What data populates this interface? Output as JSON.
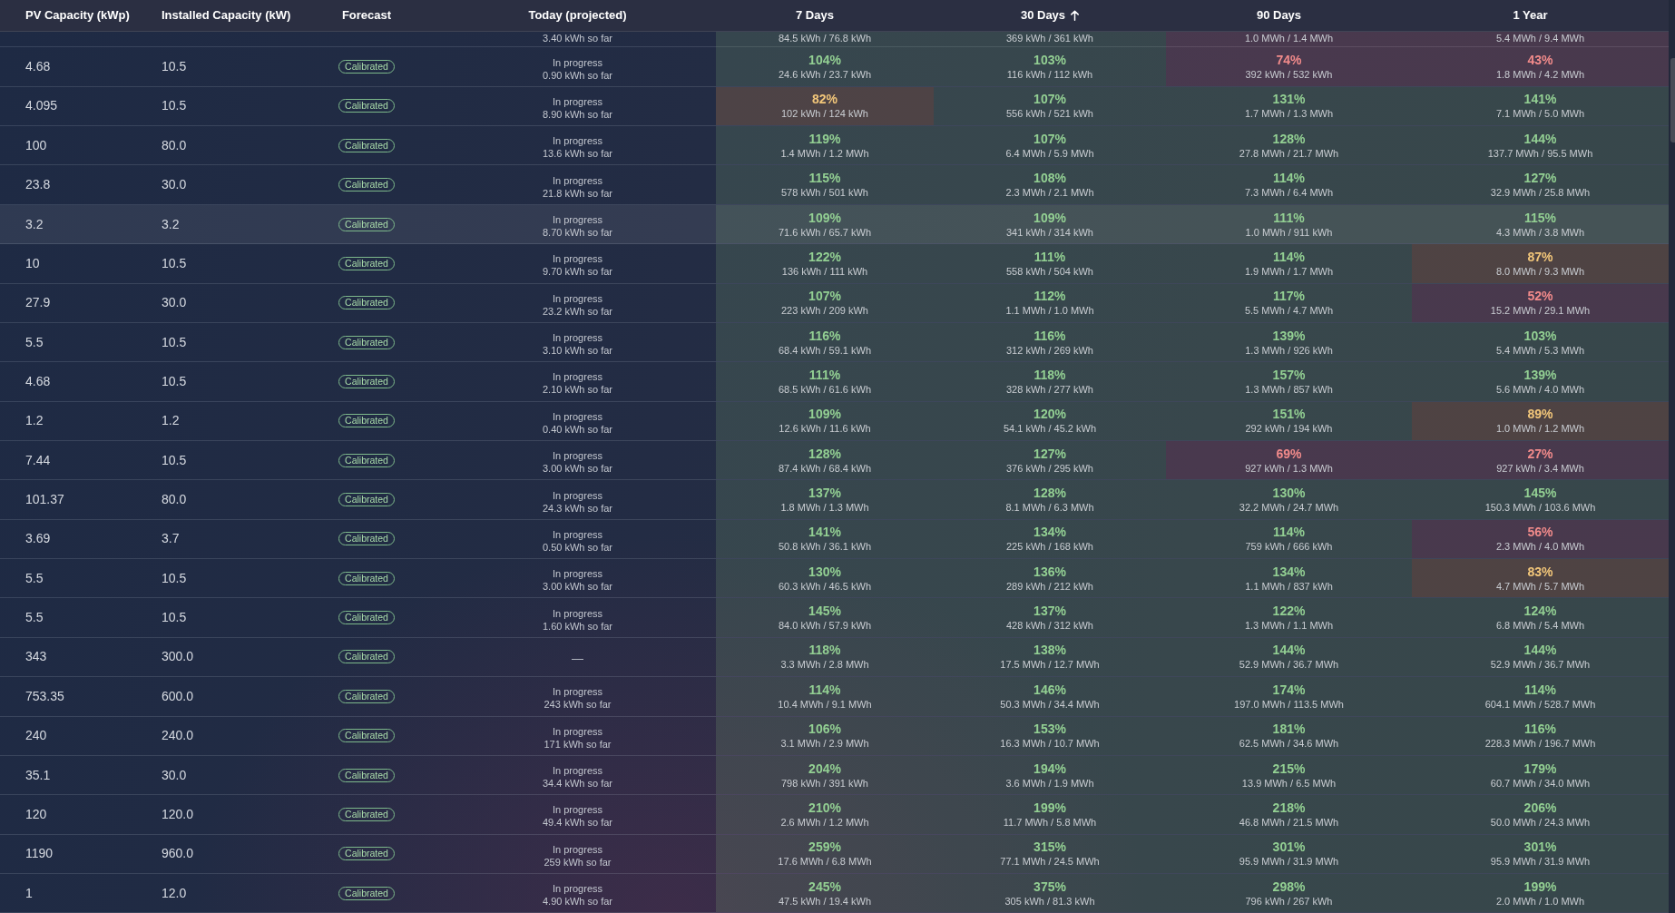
{
  "table": {
    "columns": [
      {
        "label": "PV Capacity (kWp)",
        "sorted": false
      },
      {
        "label": "Installed Capacity (kW)",
        "sorted": false
      },
      {
        "label": "Forecast",
        "sorted": false
      },
      {
        "label": "Today (projected)",
        "sorted": false
      },
      {
        "label": "7 Days",
        "sorted": false
      },
      {
        "label": "30 Days",
        "sorted": true
      },
      {
        "label": "90 Days",
        "sorted": false
      },
      {
        "label": "1 Year",
        "sorted": false
      }
    ],
    "partial_row": {
      "today_detail": "3.40 kWh so far",
      "periods": [
        {
          "energy": "84.5 kWh / 76.8 kWh",
          "kind": "good"
        },
        {
          "energy": "369 kWh / 361 kWh",
          "kind": "good"
        },
        {
          "energy": "1.0 MWh / 1.4 MWh",
          "kind": "bad"
        },
        {
          "energy": "5.4 MWh / 9.4 MWh",
          "kind": "bad"
        }
      ]
    },
    "rows": [
      {
        "pv_capacity": "4.68",
        "installed_capacity": "10.5",
        "forecast": "Calibrated",
        "today": {
          "kind": "progress",
          "label": "In progress",
          "detail": "0.90 kWh so far"
        },
        "highlighted": false,
        "periods": [
          {
            "percent": "104%",
            "energy": "24.6 kWh / 23.7 kWh",
            "kind": "good"
          },
          {
            "percent": "103%",
            "energy": "116 kWh / 112 kWh",
            "kind": "good"
          },
          {
            "percent": "74%",
            "energy": "392 kWh / 532 kWh",
            "kind": "bad"
          },
          {
            "percent": "43%",
            "energy": "1.8 MWh / 4.2 MWh",
            "kind": "bad"
          }
        ]
      },
      {
        "pv_capacity": "4.095",
        "installed_capacity": "10.5",
        "forecast": "Calibrated",
        "today": {
          "kind": "progress",
          "label": "In progress",
          "detail": "8.90 kWh so far"
        },
        "highlighted": false,
        "periods": [
          {
            "percent": "82%",
            "energy": "102 kWh / 124 kWh",
            "kind": "warn"
          },
          {
            "percent": "107%",
            "energy": "556 kWh / 521 kWh",
            "kind": "good"
          },
          {
            "percent": "131%",
            "energy": "1.7 MWh / 1.3 MWh",
            "kind": "good"
          },
          {
            "percent": "141%",
            "energy": "7.1 MWh / 5.0 MWh",
            "kind": "good"
          }
        ]
      },
      {
        "pv_capacity": "100",
        "installed_capacity": "80.0",
        "forecast": "Calibrated",
        "today": {
          "kind": "progress",
          "label": "In progress",
          "detail": "13.6 kWh so far"
        },
        "highlighted": false,
        "periods": [
          {
            "percent": "119%",
            "energy": "1.4 MWh / 1.2 MWh",
            "kind": "good"
          },
          {
            "percent": "107%",
            "energy": "6.4 MWh / 5.9 MWh",
            "kind": "good"
          },
          {
            "percent": "128%",
            "energy": "27.8 MWh / 21.7 MWh",
            "kind": "good"
          },
          {
            "percent": "144%",
            "energy": "137.7 MWh / 95.5 MWh",
            "kind": "good"
          }
        ]
      },
      {
        "pv_capacity": "23.8",
        "installed_capacity": "30.0",
        "forecast": "Calibrated",
        "today": {
          "kind": "progress",
          "label": "In progress",
          "detail": "21.8 kWh so far"
        },
        "highlighted": false,
        "periods": [
          {
            "percent": "115%",
            "energy": "578 kWh / 501 kWh",
            "kind": "good"
          },
          {
            "percent": "108%",
            "energy": "2.3 MWh / 2.1 MWh",
            "kind": "good"
          },
          {
            "percent": "114%",
            "energy": "7.3 MWh / 6.4 MWh",
            "kind": "good"
          },
          {
            "percent": "127%",
            "energy": "32.9 MWh / 25.8 MWh",
            "kind": "good"
          }
        ]
      },
      {
        "pv_capacity": "3.2",
        "installed_capacity": "3.2",
        "forecast": "Calibrated",
        "today": {
          "kind": "progress",
          "label": "In progress",
          "detail": "8.70 kWh so far"
        },
        "highlighted": true,
        "periods": [
          {
            "percent": "109%",
            "energy": "71.6 kWh / 65.7 kWh",
            "kind": "good"
          },
          {
            "percent": "109%",
            "energy": "341 kWh / 314 kWh",
            "kind": "good"
          },
          {
            "percent": "111%",
            "energy": "1.0 MWh / 911 kWh",
            "kind": "good"
          },
          {
            "percent": "115%",
            "energy": "4.3 MWh / 3.8 MWh",
            "kind": "good"
          }
        ]
      },
      {
        "pv_capacity": "10",
        "installed_capacity": "10.5",
        "forecast": "Calibrated",
        "today": {
          "kind": "progress",
          "label": "In progress",
          "detail": "9.70 kWh so far"
        },
        "highlighted": false,
        "periods": [
          {
            "percent": "122%",
            "energy": "136 kWh / 111 kWh",
            "kind": "good"
          },
          {
            "percent": "111%",
            "energy": "558 kWh / 504 kWh",
            "kind": "good"
          },
          {
            "percent": "114%",
            "energy": "1.9 MWh / 1.7 MWh",
            "kind": "good"
          },
          {
            "percent": "87%",
            "energy": "8.0 MWh / 9.3 MWh",
            "kind": "warn"
          }
        ]
      },
      {
        "pv_capacity": "27.9",
        "installed_capacity": "30.0",
        "forecast": "Calibrated",
        "today": {
          "kind": "progress",
          "label": "In progress",
          "detail": "23.2 kWh so far"
        },
        "highlighted": false,
        "periods": [
          {
            "percent": "107%",
            "energy": "223 kWh / 209 kWh",
            "kind": "good"
          },
          {
            "percent": "112%",
            "energy": "1.1 MWh / 1.0 MWh",
            "kind": "good"
          },
          {
            "percent": "117%",
            "energy": "5.5 MWh / 4.7 MWh",
            "kind": "good"
          },
          {
            "percent": "52%",
            "energy": "15.2 MWh / 29.1 MWh",
            "kind": "bad"
          }
        ]
      },
      {
        "pv_capacity": "5.5",
        "installed_capacity": "10.5",
        "forecast": "Calibrated",
        "today": {
          "kind": "progress",
          "label": "In progress",
          "detail": "3.10 kWh so far"
        },
        "highlighted": false,
        "periods": [
          {
            "percent": "116%",
            "energy": "68.4 kWh / 59.1 kWh",
            "kind": "good"
          },
          {
            "percent": "116%",
            "energy": "312 kWh / 269 kWh",
            "kind": "good"
          },
          {
            "percent": "139%",
            "energy": "1.3 MWh / 926 kWh",
            "kind": "good"
          },
          {
            "percent": "103%",
            "energy": "5.4 MWh / 5.3 MWh",
            "kind": "good"
          }
        ]
      },
      {
        "pv_capacity": "4.68",
        "installed_capacity": "10.5",
        "forecast": "Calibrated",
        "today": {
          "kind": "progress",
          "label": "In progress",
          "detail": "2.10 kWh so far"
        },
        "highlighted": false,
        "periods": [
          {
            "percent": "111%",
            "energy": "68.5 kWh / 61.6 kWh",
            "kind": "good"
          },
          {
            "percent": "118%",
            "energy": "328 kWh / 277 kWh",
            "kind": "good"
          },
          {
            "percent": "157%",
            "energy": "1.3 MWh / 857 kWh",
            "kind": "good"
          },
          {
            "percent": "139%",
            "energy": "5.6 MWh / 4.0 MWh",
            "kind": "good"
          }
        ]
      },
      {
        "pv_capacity": "1.2",
        "installed_capacity": "1.2",
        "forecast": "Calibrated",
        "today": {
          "kind": "progress",
          "label": "In progress",
          "detail": "0.40 kWh so far"
        },
        "highlighted": false,
        "periods": [
          {
            "percent": "109%",
            "energy": "12.6 kWh / 11.6 kWh",
            "kind": "good"
          },
          {
            "percent": "120%",
            "energy": "54.1 kWh / 45.2 kWh",
            "kind": "good"
          },
          {
            "percent": "151%",
            "energy": "292 kWh / 194 kWh",
            "kind": "good"
          },
          {
            "percent": "89%",
            "energy": "1.0 MWh / 1.2 MWh",
            "kind": "warn"
          }
        ]
      },
      {
        "pv_capacity": "7.44",
        "installed_capacity": "10.5",
        "forecast": "Calibrated",
        "today": {
          "kind": "progress",
          "label": "In progress",
          "detail": "3.00 kWh so far"
        },
        "highlighted": false,
        "periods": [
          {
            "percent": "128%",
            "energy": "87.4 kWh / 68.4 kWh",
            "kind": "good"
          },
          {
            "percent": "127%",
            "energy": "376 kWh / 295 kWh",
            "kind": "good"
          },
          {
            "percent": "69%",
            "energy": "927 kWh / 1.3 MWh",
            "kind": "bad"
          },
          {
            "percent": "27%",
            "energy": "927 kWh / 3.4 MWh",
            "kind": "bad"
          }
        ]
      },
      {
        "pv_capacity": "101.37",
        "installed_capacity": "80.0",
        "forecast": "Calibrated",
        "today": {
          "kind": "progress",
          "label": "In progress",
          "detail": "24.3 kWh so far"
        },
        "highlighted": false,
        "periods": [
          {
            "percent": "137%",
            "energy": "1.8 MWh / 1.3 MWh",
            "kind": "good"
          },
          {
            "percent": "128%",
            "energy": "8.1 MWh / 6.3 MWh",
            "kind": "good"
          },
          {
            "percent": "130%",
            "energy": "32.2 MWh / 24.7 MWh",
            "kind": "good"
          },
          {
            "percent": "145%",
            "energy": "150.3 MWh / 103.6 MWh",
            "kind": "good"
          }
        ]
      },
      {
        "pv_capacity": "3.69",
        "installed_capacity": "3.7",
        "forecast": "Calibrated",
        "today": {
          "kind": "progress",
          "label": "In progress",
          "detail": "0.50 kWh so far"
        },
        "highlighted": false,
        "periods": [
          {
            "percent": "141%",
            "energy": "50.8 kWh / 36.1 kWh",
            "kind": "good"
          },
          {
            "percent": "134%",
            "energy": "225 kWh / 168 kWh",
            "kind": "good"
          },
          {
            "percent": "114%",
            "energy": "759 kWh / 666 kWh",
            "kind": "good"
          },
          {
            "percent": "56%",
            "energy": "2.3 MWh / 4.0 MWh",
            "kind": "bad"
          }
        ]
      },
      {
        "pv_capacity": "5.5",
        "installed_capacity": "10.5",
        "forecast": "Calibrated",
        "today": {
          "kind": "progress",
          "label": "In progress",
          "detail": "3.00 kWh so far"
        },
        "highlighted": false,
        "periods": [
          {
            "percent": "130%",
            "energy": "60.3 kWh / 46.5 kWh",
            "kind": "good"
          },
          {
            "percent": "136%",
            "energy": "289 kWh / 212 kWh",
            "kind": "good"
          },
          {
            "percent": "134%",
            "energy": "1.1 MWh / 837 kWh",
            "kind": "good"
          },
          {
            "percent": "83%",
            "energy": "4.7 MWh / 5.7 MWh",
            "kind": "warn"
          }
        ]
      },
      {
        "pv_capacity": "5.5",
        "installed_capacity": "10.5",
        "forecast": "Calibrated",
        "today": {
          "kind": "progress",
          "label": "In progress",
          "detail": "1.60 kWh so far"
        },
        "highlighted": false,
        "periods": [
          {
            "percent": "145%",
            "energy": "84.0 kWh / 57.9 kWh",
            "kind": "good"
          },
          {
            "percent": "137%",
            "energy": "428 kWh / 312 kWh",
            "kind": "good"
          },
          {
            "percent": "122%",
            "energy": "1.3 MWh / 1.1 MWh",
            "kind": "good"
          },
          {
            "percent": "124%",
            "energy": "6.8 MWh / 5.4 MWh",
            "kind": "good"
          }
        ]
      },
      {
        "pv_capacity": "343",
        "installed_capacity": "300.0",
        "forecast": "Calibrated",
        "today": {
          "kind": "none",
          "label": "—"
        },
        "highlighted": false,
        "periods": [
          {
            "percent": "118%",
            "energy": "3.3 MWh / 2.8 MWh",
            "kind": "good"
          },
          {
            "percent": "138%",
            "energy": "17.5 MWh / 12.7 MWh",
            "kind": "good"
          },
          {
            "percent": "144%",
            "energy": "52.9 MWh / 36.7 MWh",
            "kind": "good"
          },
          {
            "percent": "144%",
            "energy": "52.9 MWh / 36.7 MWh",
            "kind": "good"
          }
        ]
      },
      {
        "pv_capacity": "753.35",
        "installed_capacity": "600.0",
        "forecast": "Calibrated",
        "today": {
          "kind": "progress",
          "label": "In progress",
          "detail": "243 kWh so far"
        },
        "highlighted": false,
        "periods": [
          {
            "percent": "114%",
            "energy": "10.4 MWh / 9.1 MWh",
            "kind": "good"
          },
          {
            "percent": "146%",
            "energy": "50.3 MWh / 34.4 MWh",
            "kind": "good"
          },
          {
            "percent": "174%",
            "energy": "197.0 MWh / 113.5 MWh",
            "kind": "good"
          },
          {
            "percent": "114%",
            "energy": "604.1 MWh / 528.7 MWh",
            "kind": "good"
          }
        ]
      },
      {
        "pv_capacity": "240",
        "installed_capacity": "240.0",
        "forecast": "Calibrated",
        "today": {
          "kind": "progress",
          "label": "In progress",
          "detail": "171 kWh so far"
        },
        "highlighted": false,
        "periods": [
          {
            "percent": "106%",
            "energy": "3.1 MWh / 2.9 MWh",
            "kind": "good"
          },
          {
            "percent": "153%",
            "energy": "16.3 MWh / 10.7 MWh",
            "kind": "good"
          },
          {
            "percent": "181%",
            "energy": "62.5 MWh / 34.6 MWh",
            "kind": "good"
          },
          {
            "percent": "116%",
            "energy": "228.3 MWh / 196.7 MWh",
            "kind": "good"
          }
        ]
      },
      {
        "pv_capacity": "35.1",
        "installed_capacity": "30.0",
        "forecast": "Calibrated",
        "today": {
          "kind": "progress",
          "label": "In progress",
          "detail": "34.4 kWh so far"
        },
        "highlighted": false,
        "periods": [
          {
            "percent": "204%",
            "energy": "798 kWh / 391 kWh",
            "kind": "good"
          },
          {
            "percent": "194%",
            "energy": "3.6 MWh / 1.9 MWh",
            "kind": "good"
          },
          {
            "percent": "215%",
            "energy": "13.9 MWh / 6.5 MWh",
            "kind": "good"
          },
          {
            "percent": "179%",
            "energy": "60.7 MWh / 34.0 MWh",
            "kind": "good"
          }
        ]
      },
      {
        "pv_capacity": "120",
        "installed_capacity": "120.0",
        "forecast": "Calibrated",
        "today": {
          "kind": "progress",
          "label": "In progress",
          "detail": "49.4 kWh so far"
        },
        "highlighted": false,
        "periods": [
          {
            "percent": "210%",
            "energy": "2.6 MWh / 1.2 MWh",
            "kind": "good"
          },
          {
            "percent": "199%",
            "energy": "11.7 MWh / 5.8 MWh",
            "kind": "good"
          },
          {
            "percent": "218%",
            "energy": "46.8 MWh / 21.5 MWh",
            "kind": "good"
          },
          {
            "percent": "206%",
            "energy": "50.0 MWh / 24.3 MWh",
            "kind": "good"
          }
        ]
      },
      {
        "pv_capacity": "1190",
        "installed_capacity": "960.0",
        "forecast": "Calibrated",
        "today": {
          "kind": "progress",
          "label": "In progress",
          "detail": "259 kWh so far"
        },
        "highlighted": false,
        "periods": [
          {
            "percent": "259%",
            "energy": "17.6 MWh / 6.8 MWh",
            "kind": "good"
          },
          {
            "percent": "315%",
            "energy": "77.1 MWh / 24.5 MWh",
            "kind": "good"
          },
          {
            "percent": "301%",
            "energy": "95.9 MWh / 31.9 MWh",
            "kind": "good"
          },
          {
            "percent": "301%",
            "energy": "95.9 MWh / 31.9 MWh",
            "kind": "good"
          }
        ]
      },
      {
        "pv_capacity": "1",
        "installed_capacity": "12.0",
        "forecast": "Calibrated",
        "today": {
          "kind": "progress",
          "label": "In progress",
          "detail": "4.90 kWh so far"
        },
        "highlighted": false,
        "periods": [
          {
            "percent": "245%",
            "energy": "47.5 kWh / 19.4 kWh",
            "kind": "good"
          },
          {
            "percent": "375%",
            "energy": "305 kWh / 81.3 kWh",
            "kind": "good"
          },
          {
            "percent": "298%",
            "energy": "796 kWh / 267 kWh",
            "kind": "good"
          },
          {
            "percent": "199%",
            "energy": "2.0 MWh / 1.0 MWh",
            "kind": "good"
          }
        ]
      }
    ]
  }
}
